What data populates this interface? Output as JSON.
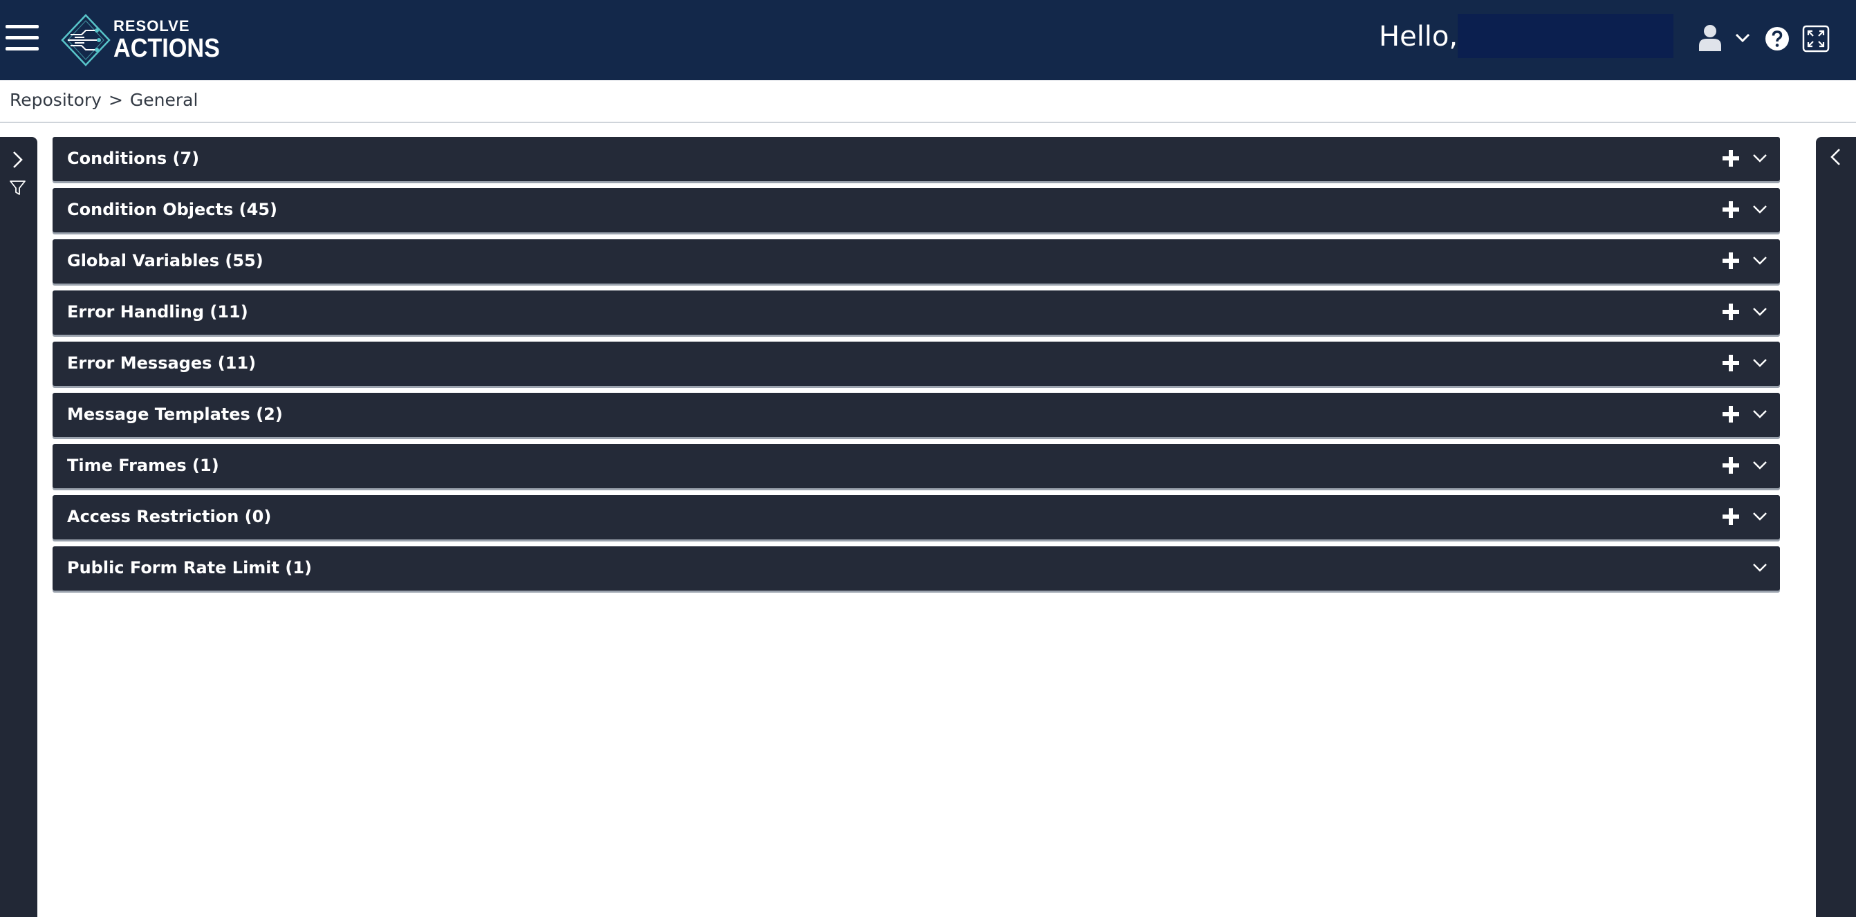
{
  "header": {
    "logo_line1": "RESOLVE",
    "logo_line2": "ACTIONS",
    "greeting": "Hello,",
    "username": ""
  },
  "breadcrumb": {
    "items": [
      "Repository",
      "General"
    ],
    "separator": ">"
  },
  "panels": [
    {
      "title": "Conditions (7)",
      "has_add": true
    },
    {
      "title": "Condition Objects (45)",
      "has_add": true
    },
    {
      "title": "Global Variables (55)",
      "has_add": true
    },
    {
      "title": "Error Handling (11)",
      "has_add": true
    },
    {
      "title": "Error Messages (11)",
      "has_add": true
    },
    {
      "title": "Message Templates (2)",
      "has_add": true
    },
    {
      "title": "Time Frames (1)",
      "has_add": true
    },
    {
      "title": "Access Restriction (0)",
      "has_add": true
    },
    {
      "title": "Public Form Rate Limit (1)",
      "has_add": false
    }
  ],
  "icons": {
    "menu": "hamburger-menu-icon",
    "user": "user-icon",
    "dropdown": "chevron-down-icon",
    "help": "help-circle-icon",
    "fullscreen": "expand-icon",
    "left_rail_expand": "chevron-right-icon",
    "filter": "filter-icon",
    "right_rail_expand": "chevron-left-icon",
    "add": "plus-icon",
    "panel_toggle": "chevron-down-icon"
  },
  "colors": {
    "topbar": "#13284a",
    "panel": "#242a38",
    "rail": "#222836",
    "username_box": "#0b1f4f"
  }
}
